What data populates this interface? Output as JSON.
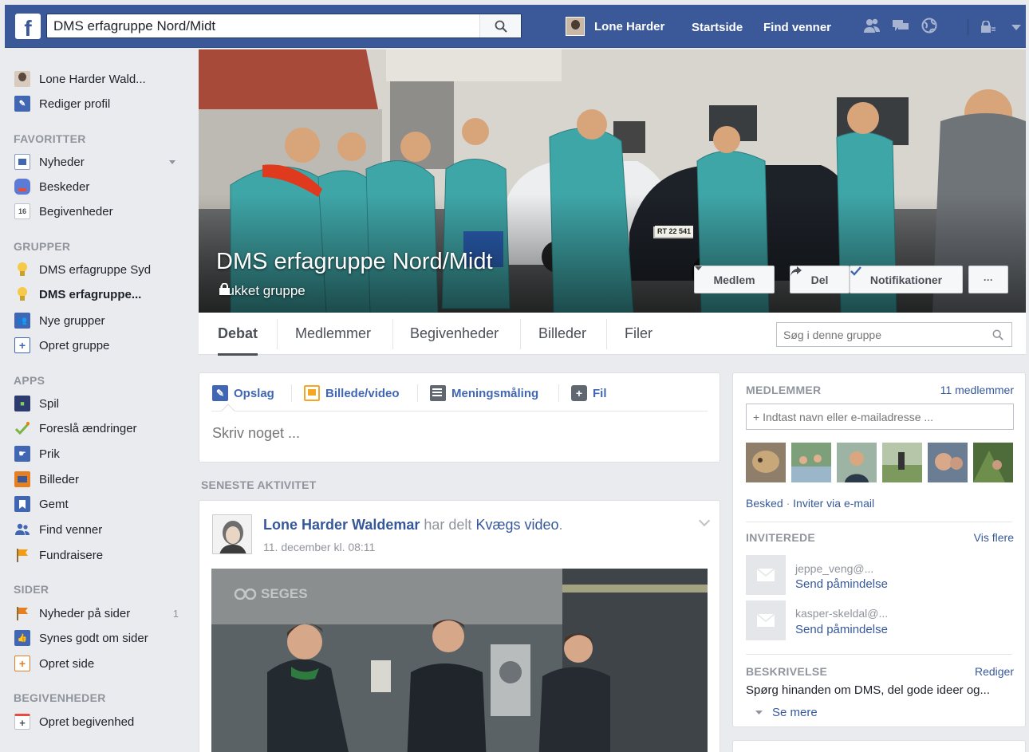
{
  "topbar": {
    "logo_letter": "f",
    "search_value": "DMS erfagruppe Nord/Midt",
    "user_name": "Lone Harder",
    "home_label": "Startside",
    "find_friends_label": "Find venner",
    "icons": [
      "friend-requests-icon",
      "messages-icon",
      "notifications-globe-icon",
      "privacy-shortcuts-icon",
      "account-menu-chevron-icon"
    ]
  },
  "sidebar": {
    "profile_name": "Lone Harder Wald...",
    "edit_profile": "Rediger profil",
    "favorites_header": "FAVORITTER",
    "favorites": [
      "Nyheder",
      "Beskeder",
      "Begivenheder"
    ],
    "calendar_day": "16",
    "groups_header": "GRUPPER",
    "groups": [
      "DMS erfagruppe Syd",
      "DMS erfagruppe...",
      "Nye grupper",
      "Opret gruppe"
    ],
    "apps_header": "APPS",
    "apps": [
      "Spil",
      "Foreslå ændringer",
      "Prik",
      "Billeder",
      "Gemt",
      "Find venner",
      "Fundraisere"
    ],
    "pages_header": "SIDER",
    "pages": [
      "Nyheder på sider",
      "Synes godt om sider",
      "Opret side"
    ],
    "pages_count": "1",
    "events_header": "BEGIVENHEDER",
    "events": [
      "Opret begivenhed"
    ]
  },
  "cover": {
    "group_name": "DMS erfagruppe Nord/Midt",
    "privacy": "Lukket gruppe",
    "member_button": "Medlem",
    "share_button": "Del",
    "notifications_button": "Notifikationer",
    "more_button": "···",
    "license_plate": "RT 22 541"
  },
  "tabs": {
    "items": [
      "Debat",
      "Medlemmer",
      "Begivenheder",
      "Billeder",
      "Filer"
    ],
    "active": "Debat",
    "search_placeholder": "Søg i denne gruppe"
  },
  "composer": {
    "tabs": [
      "Opslag",
      "Billede/video",
      "Meningsmåling",
      "Fil"
    ],
    "placeholder": "Skriv noget ..."
  },
  "feed": {
    "section_header": "SENESTE AKTIVITET",
    "post": {
      "author": "Lone Harder Waldemar",
      "verb": " har delt ",
      "link": "Kvægs video",
      "period": ".",
      "timestamp": "11. december kl. 08:11",
      "video_watermark": "SEGES"
    }
  },
  "right": {
    "members_header": "MEDLEMMER",
    "members_count": "11 medlemmer",
    "add_member_placeholder": "+ Indtast navn eller e-mailadresse ...",
    "message_link": "Besked",
    "separator": " · ",
    "invite_link": "Inviter via e-mail",
    "invited_header": "INVITEREDE",
    "see_more": "Vis flere",
    "invited": [
      {
        "name": "jeppe_veng@...",
        "action": "Send påmindelse"
      },
      {
        "name": "kasper-skeldal@...",
        "action": "Send påmindelse"
      }
    ],
    "description_header": "BESKRIVELSE",
    "edit_link": "Rediger",
    "description": "Spørg hinanden om DMS, del gode ideer og...",
    "see_more_desc": "Se mere"
  },
  "colors": {
    "brand": "#3b5998",
    "link": "#365899",
    "background": "#e9ebee",
    "coverall": "#3fa6a8"
  }
}
